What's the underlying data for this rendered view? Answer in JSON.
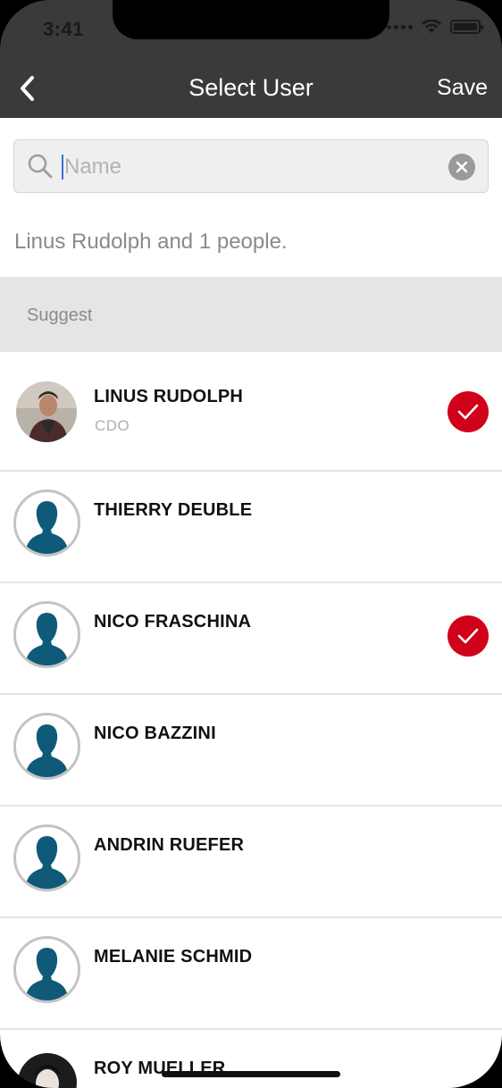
{
  "status_bar": {
    "time": "3:41",
    "icons": [
      "signal-dots-icon",
      "wifi-icon",
      "battery-icon"
    ]
  },
  "nav": {
    "back_icon": "chevron-left-icon",
    "title": "Select User",
    "save_label": "Save"
  },
  "search": {
    "placeholder": "Name",
    "value": "",
    "search_icon": "search-icon",
    "clear_icon": "clear-icon"
  },
  "summary": "Linus Rudolph and 1 people.",
  "section": {
    "title": "Suggest"
  },
  "colors": {
    "nav_background": "#3a3a3a",
    "accent_red": "#d0021b",
    "avatar_silhouette": "#0f5a78"
  },
  "users": [
    {
      "name": "LINUS RUDOLPH",
      "role": "CDO",
      "selected": true,
      "avatar": "photo"
    },
    {
      "name": "THIERRY DEUBLE",
      "role": "",
      "selected": false,
      "avatar": "placeholder"
    },
    {
      "name": "NICO FRASCHINA",
      "role": "",
      "selected": true,
      "avatar": "placeholder"
    },
    {
      "name": "NICO BAZZINI",
      "role": "",
      "selected": false,
      "avatar": "placeholder"
    },
    {
      "name": "ANDRIN RUEFER",
      "role": "",
      "selected": false,
      "avatar": "placeholder"
    },
    {
      "name": "MELANIE SCHMID",
      "role": "",
      "selected": false,
      "avatar": "placeholder"
    },
    {
      "name": "ROY MUELLER",
      "role": "",
      "selected": false,
      "avatar": "photo"
    }
  ]
}
